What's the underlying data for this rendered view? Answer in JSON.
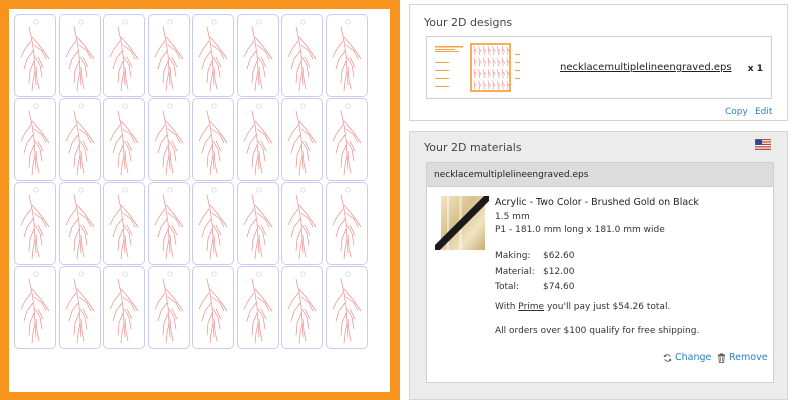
{
  "preview": {
    "frame_color": "#f7941d",
    "tag_outline_color": "#cbcbf0",
    "engraving_color": "#f08a8a",
    "grid_columns": 8,
    "grid_rows": 4
  },
  "designs": {
    "title": "Your 2D designs",
    "item": {
      "filename": "necklacemultiplelineengraved.eps",
      "quantity": "x 1"
    },
    "copy_label": "Copy",
    "edit_label": "Edit"
  },
  "materials": {
    "title": "Your 2D materials",
    "flag_icon": "us-flag-icon",
    "file_header": "necklacemultiplelineengraved.eps",
    "material_name": "Acrylic - Two Color - Brushed Gold on Black",
    "thickness": "1.5 mm",
    "size": "P1 - 181.0 mm long x 181.0 mm wide",
    "prices": [
      {
        "label": "Making:",
        "value": "$62.60"
      },
      {
        "label": "Material:",
        "value": "$12.00"
      },
      {
        "label": "Total:",
        "value": "$74.60"
      }
    ],
    "prime_prefix": "With ",
    "prime_link": "Prime",
    "prime_suffix": " you'll pay just $54.26 total.",
    "shipping_note": "All orders over $100 qualify for free shipping.",
    "change_label": "Change",
    "remove_label": "Remove"
  },
  "colors": {
    "link": "#2a7fc0",
    "panel_bg": "#ececec",
    "header_bg": "#dcdcdc"
  }
}
